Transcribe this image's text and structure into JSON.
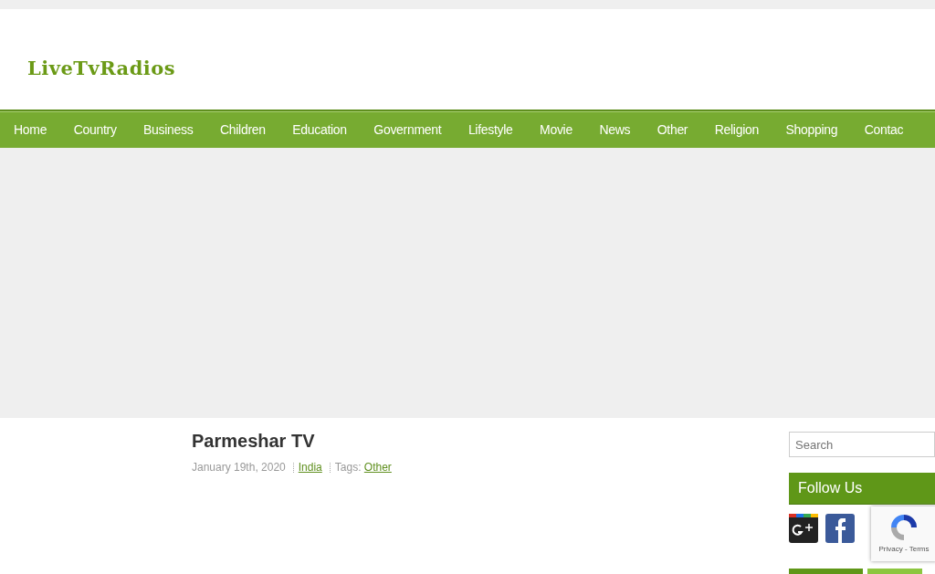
{
  "site": {
    "logo": "LiveTvRadios"
  },
  "nav": {
    "items": [
      {
        "label": "Home"
      },
      {
        "label": "Country"
      },
      {
        "label": "Business"
      },
      {
        "label": "Children"
      },
      {
        "label": "Education"
      },
      {
        "label": "Government"
      },
      {
        "label": "Lifestyle"
      },
      {
        "label": "Movie"
      },
      {
        "label": "News"
      },
      {
        "label": "Other"
      },
      {
        "label": "Religion"
      },
      {
        "label": "Shopping"
      },
      {
        "label": "Contac"
      }
    ]
  },
  "post": {
    "title": "Parmeshar TV",
    "date": "January 19th, 2020",
    "category": "India",
    "tags_label": "Tags:",
    "tags": [
      "Other"
    ]
  },
  "sidebar": {
    "search": {
      "placeholder": "Search"
    },
    "follow_heading": "Follow Us"
  },
  "recaptcha": {
    "links": "Privacy - Terms"
  }
}
